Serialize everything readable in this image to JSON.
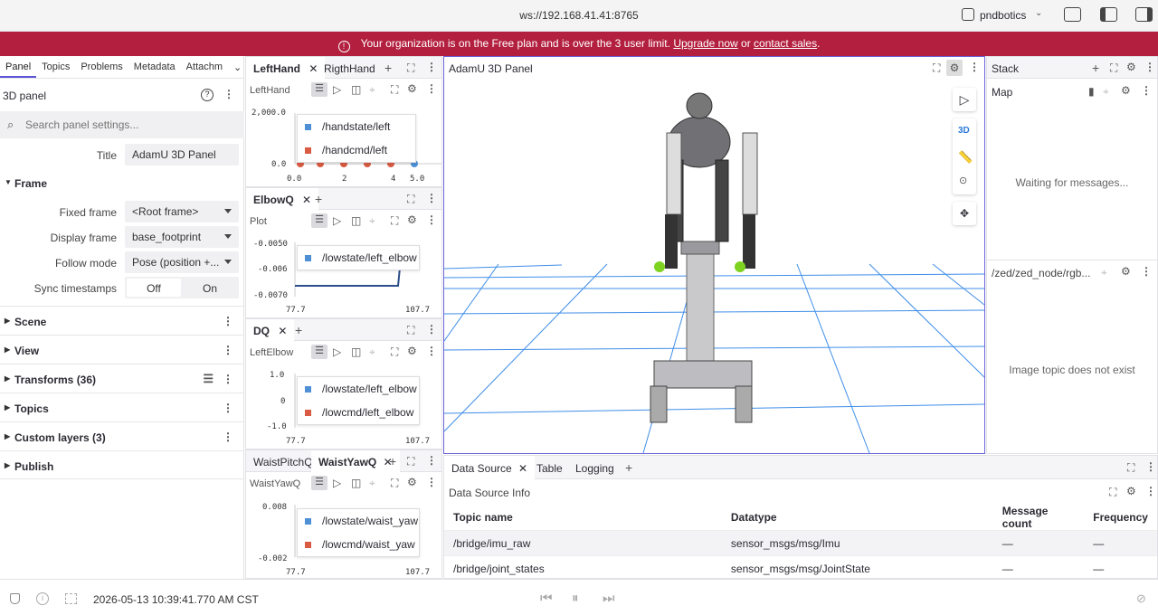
{
  "titlebar": {
    "url": "ws://192.168.41.41:8765",
    "org": "pndbotics"
  },
  "banner": {
    "message": "Your organization is on the Free plan and is over the 3 user limit. ",
    "upgrade": "Upgrade now",
    "or": " or ",
    "contact": "contact sales",
    "end": "."
  },
  "sidebar": {
    "tabs": [
      "Panel",
      "Topics",
      "Problems",
      "Metadata",
      "Attachm"
    ],
    "panel_title": "3D panel",
    "search_placeholder": "Search panel settings...",
    "title_label": "Title",
    "title_value": "AdamU 3D Panel",
    "frame_section": "Frame",
    "fixed_frame_label": "Fixed frame",
    "fixed_frame_value": "<Root frame>",
    "display_frame_label": "Display frame",
    "display_frame_value": "base_footprint",
    "follow_mode_label": "Follow mode",
    "follow_mode_value": "Pose (position +...",
    "sync_label": "Sync timestamps",
    "sync_off": "Off",
    "sync_on": "On",
    "sections": [
      "Scene",
      "View",
      "Transforms (36)",
      "Topics",
      "Custom layers (3)",
      "Publish"
    ]
  },
  "plots": {
    "lefthand": {
      "tabs": [
        "LeftHand",
        "RigthHand"
      ],
      "name": "LeftHand",
      "series": [
        "/handstate/left",
        "/handcmd/left"
      ],
      "y_ticks": [
        "2,000.0",
        "0.0"
      ],
      "x_ticks": [
        "0.0",
        "2",
        "4",
        "5.0"
      ]
    },
    "elbowq": {
      "tabs": [
        "ElbowQ"
      ],
      "name": "Plot",
      "series": [
        "/lowstate/left_elbow"
      ],
      "y_ticks": [
        "-0.0050",
        "-0.006",
        "-0.0070"
      ],
      "x_ticks": [
        "77.7",
        "107.7"
      ]
    },
    "dq": {
      "tabs": [
        "DQ"
      ],
      "name": "LeftElbow",
      "series": [
        "/lowstate/left_elbow",
        "/lowcmd/left_elbow"
      ],
      "y_ticks": [
        "1.0",
        "0",
        "-1.0"
      ],
      "x_ticks": [
        "77.7",
        "107.7"
      ]
    },
    "waist": {
      "tabs": [
        "WaistPitchQ",
        "WaistYawQ"
      ],
      "name": "WaistYawQ",
      "series": [
        "/lowstate/waist_yaw",
        "/lowcmd/waist_yaw"
      ],
      "y_ticks": [
        "0.008",
        "-0.002"
      ],
      "x_ticks": [
        "77.7",
        "107.7"
      ]
    }
  },
  "viewport": {
    "title": "AdamU 3D Panel",
    "mode_3d": "3D"
  },
  "stack": {
    "title": "Stack",
    "map_title": "Map",
    "map_status": "Waiting for messages...",
    "image_topic": "/zed/zed_node/rgb...",
    "image_status": "Image topic does not exist"
  },
  "datasource": {
    "tabs": [
      "Data Source",
      "Table",
      "Logging"
    ],
    "subtitle": "Data Source Info",
    "columns": [
      "Topic name",
      "Datatype",
      "Message count",
      "Frequency"
    ],
    "rows": [
      [
        "/bridge/imu_raw",
        "sensor_msgs/msg/Imu",
        "—",
        "—"
      ],
      [
        "/bridge/joint_states",
        "sensor_msgs/msg/JointState",
        "—",
        "—"
      ]
    ]
  },
  "bottombar": {
    "timestamp": "2026-05-13 10:39:41.770 AM CST"
  },
  "colors": {
    "banner": "#b3203f",
    "accent": "#5b54d4",
    "series_blue": "#4e8fd6",
    "series_red": "#d95b43",
    "grid_blue": "#3f8ee8"
  }
}
